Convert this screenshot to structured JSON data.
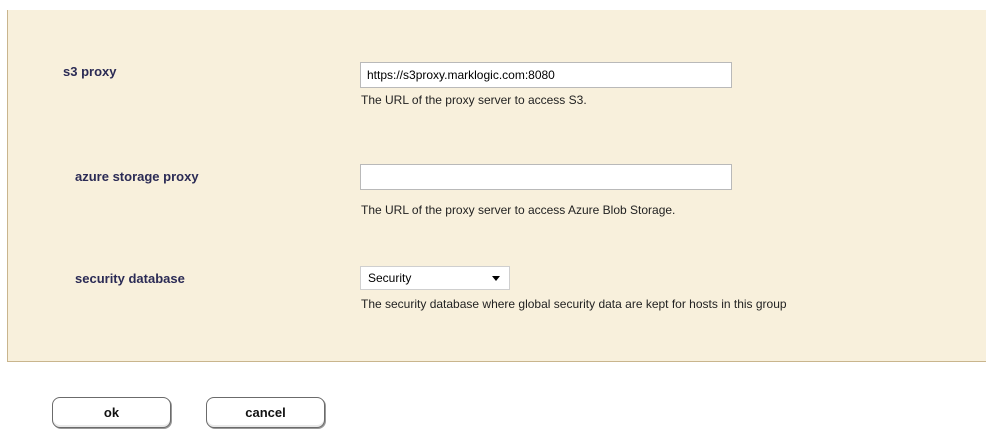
{
  "form": {
    "s3_proxy": {
      "label": "s3 proxy",
      "value": "https://s3proxy.marklogic.com:8080",
      "help": "The URL of the proxy server to access S3."
    },
    "azure_storage_proxy": {
      "label": "azure storage proxy",
      "value": "",
      "help": "The URL of the proxy server to access Azure Blob Storage."
    },
    "security_database": {
      "label": "security database",
      "selected": "Security",
      "help": "The security database where global security data are kept for hosts in this group"
    }
  },
  "buttons": {
    "ok_label": "ok",
    "cancel_label": "cancel"
  },
  "colors": {
    "panel_background": "#f8f0dc",
    "panel_border": "#c9b58d",
    "label_text": "#2b2b55"
  }
}
